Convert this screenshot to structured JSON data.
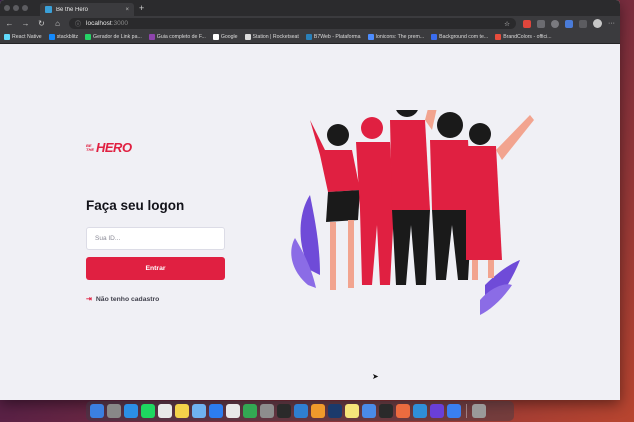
{
  "browser": {
    "tab_title": "Be the Hero",
    "tab_close": "×",
    "new_tab": "+",
    "url_host": "localhost",
    "url_port": ":3000",
    "bookmarks": [
      {
        "label": "React Native",
        "color": "#61dafb"
      },
      {
        "label": "stackblitz",
        "color": "#1389fd"
      },
      {
        "label": "Gerador de Link pa...",
        "color": "#25d366"
      },
      {
        "label": "Guia completo de F...",
        "color": "#8e44ad"
      },
      {
        "label": "Google",
        "color": "#ffffff"
      },
      {
        "label": "Station | Rocketseat",
        "color": "#dddddd"
      },
      {
        "label": "B7Web - Plataforma",
        "color": "#2980b9"
      },
      {
        "label": "Ionicons: The prem...",
        "color": "#4d8dff"
      },
      {
        "label": "Background com te...",
        "color": "#3a6df0"
      },
      {
        "label": "BrandColors - offici...",
        "color": "#e74c3c"
      }
    ]
  },
  "page": {
    "logo_small": [
      "BE",
      "THE"
    ],
    "logo_big": "HERO",
    "title": "Faça seu logon",
    "input_placeholder": "Sua ID...",
    "button_label": "Entrar",
    "register_link": "Não tenho cadastro"
  },
  "colors": {
    "brand": "#e02041",
    "text_dark": "#13131a",
    "background": "#f0f0f5"
  },
  "dock_icons": [
    "finder",
    "launchpad",
    "safari",
    "spotify",
    "bear",
    "notes",
    "preview",
    "app-store",
    "chrome",
    "edge",
    "instruments",
    "monitor",
    "vscode",
    "sublime",
    "photoshop",
    "stickies",
    "mail",
    "terminal",
    "figma",
    "vscode-insiders",
    "podcasts",
    "app-store-2",
    "trash"
  ]
}
